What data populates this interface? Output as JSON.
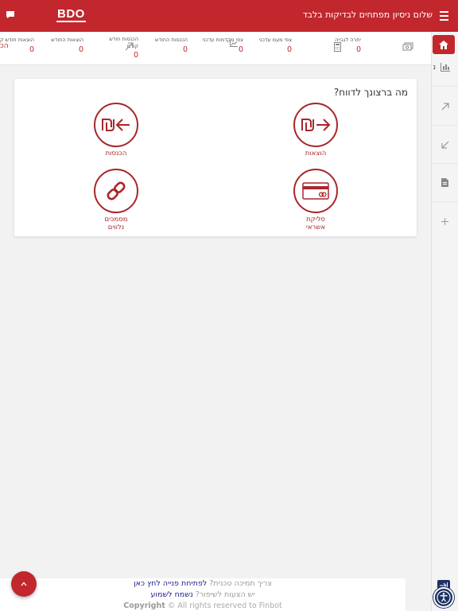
{
  "header": {
    "title": "שלום ניסיון מפתחים לבדיקות בלבד",
    "logo_text": "BDO",
    "bg_color": "#c1272d"
  },
  "stats": [
    {
      "label": "יתרה לגבייה",
      "value": "0",
      "icon": "money-icon"
    },
    {
      "label": "",
      "value": "",
      "icon": "calculator-icon"
    },
    {
      "label": "צפי מעמ עדכני",
      "value": "0"
    },
    {
      "label": "צפי מקדמות עדכני",
      "value": "0",
      "icon": "chart-icon"
    },
    {
      "label": "הכנסות החודש",
      "value": "0"
    },
    {
      "label_line1": "הכנסות חודש",
      "label_line2": "קודם",
      "value": "0",
      "icon": "arrow-up-right-icon"
    },
    {
      "label": "הוצאות החודש",
      "value": "0"
    },
    {
      "label": "הוצאות חודש קודם",
      "value": "0"
    }
  ],
  "stats_cut_label": "הכ",
  "sidebar": {
    "items": [
      {
        "icon": "home-icon"
      },
      {
        "icon": "chart-icon",
        "label": "נ"
      },
      {
        "icon": "arrow-up-right-icon"
      },
      {
        "icon": "arrow-down-left-icon"
      },
      {
        "icon": "document-icon"
      },
      {
        "icon": "plus-icon"
      }
    ]
  },
  "card": {
    "title": "מה ברצונך לדווח?",
    "tiles": [
      {
        "label": "הוצאות",
        "icon": "shekel-arrow-right-icon"
      },
      {
        "label": "הכנסות",
        "icon": "shekel-arrow-left-icon"
      },
      {
        "label": "סליקת אשראי",
        "icon": "credit-card-icon"
      },
      {
        "label": "מסמכים נלווים",
        "icon": "link-icon"
      }
    ]
  },
  "footer": {
    "support_q": "צריך תמיכה טכנית?",
    "support_link": "לפתיחת פנייה לחץ כאן",
    "suggest_q": "יש הצעות לשיפור?",
    "suggest_link": "נשמח לשמוע",
    "copyright_bold": "Copyright",
    "copyright_rest": "© All rights reserved to Finbot"
  },
  "colors": {
    "accent": "#c1272d",
    "accessibility": "#1d3264"
  }
}
